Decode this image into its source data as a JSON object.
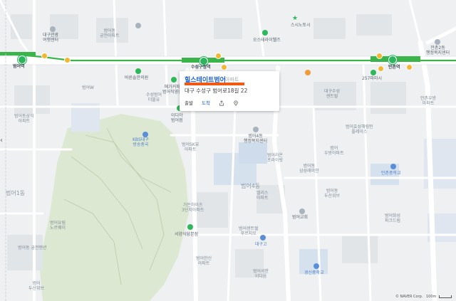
{
  "popup": {
    "name": "힐스테이트범어",
    "category": "아파트",
    "address": "대구 수성구 범어로18길 22",
    "depart": "출발",
    "arrive": "도착"
  },
  "stations": {
    "beomeo": "범어역",
    "suseong": "수성구청역",
    "manchon": "만촌역"
  },
  "places": {
    "daegu_tour": "대구관광\n여행센터",
    "oasis": "오스테라이웰즈",
    "sisha": "스시노토시",
    "manchon_welfare": "만촌2동\n행정복지센터",
    "sky_lake": "하나은행\n대구은행",
    "baron": "바른솔한의원",
    "mega_coffee": "메가커피\n범어직영점",
    "ediya": "이디야\n범어점",
    "beomeo4_center": "범어4동\n행정복지센터",
    "suseong_office": "수성구청",
    "beomeo_church": "범어교회",
    "seoyang_restaurant": "서양식당본점",
    "kbs": "KBS대구\n방송총국",
    "gs25": "GS25",
    "beomeo1": "범어1동",
    "beomeo4": "범어4동",
    "mc_pharmacy": "257파마시",
    "manchon_middle": "만촌중학교",
    "bukmun": "청호병원",
    "kyungsin_middle": "경신중학교",
    "daegu_hs": "대구고",
    "jeongwha": "정화여고"
  },
  "apartments": [
    "범어SK뷰\n아파트",
    "범어라온\n프라이빗",
    "범어동\n삼성래미안",
    "범어\n우방아파트",
    "범어효성해링턴\n플레이스",
    "대구수성\n센트럴",
    "범어동\n궁전아파트",
    "범어동삼익\n아파트",
    "범어유림\n노르웨이",
    "만촌우방\n아파트",
    "범어동\n두산위브",
    "엘리스\n아파트",
    "힐스테이트범어",
    "가든하이츠\n3단지아파트",
    "범어센트럴\n푸르지오",
    "범어한신\n아파트",
    "범어동 궁전맨션",
    "범어서한\n이다음",
    "수성범어\n더블유",
    "범어W",
    "범어화성\n파크드림",
    "범어\n두산위브"
  ],
  "credit": {
    "naver": "© NAVER Corp.",
    "scale": "100m"
  },
  "icons": {
    "card_share": "share-icon",
    "card_pin": "pin-icon",
    "nav": "chevron-left-icon"
  },
  "colors": {
    "subway_line": "#3bb54a",
    "highlight": "#f05a12",
    "link": "#1a5fd0",
    "park": "#dbe7cf",
    "water": "#c9d9ee"
  }
}
